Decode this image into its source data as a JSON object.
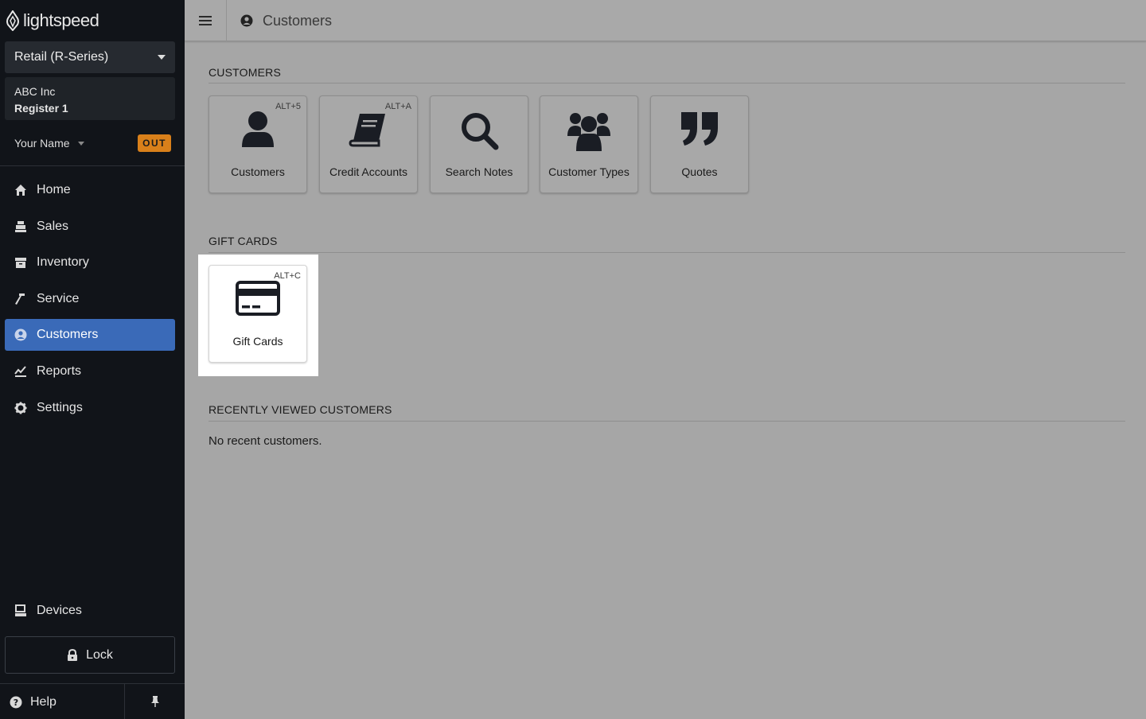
{
  "brand": {
    "logo_text": "lightspeed"
  },
  "sidebar": {
    "store_select": "Retail (R-Series)",
    "company": "ABC Inc",
    "register": "Register 1",
    "user_name": "Your Name",
    "status_badge": "OUT",
    "nav": [
      {
        "label": "Home",
        "icon": "home-icon"
      },
      {
        "label": "Sales",
        "icon": "register-icon"
      },
      {
        "label": "Inventory",
        "icon": "inventory-icon"
      },
      {
        "label": "Service",
        "icon": "hammer-icon"
      },
      {
        "label": "Customers",
        "icon": "user-circle-icon",
        "active": true
      },
      {
        "label": "Reports",
        "icon": "chart-icon"
      },
      {
        "label": "Settings",
        "icon": "gear-icon"
      }
    ],
    "devices_label": "Devices",
    "lock_label": "Lock",
    "help_label": "Help"
  },
  "header": {
    "title": "Customers"
  },
  "sections": {
    "customers": {
      "title": "CUSTOMERS",
      "tiles": [
        {
          "label": "Customers",
          "shortcut": "ALT+5",
          "icon": "user-icon"
        },
        {
          "label": "Credit Accounts",
          "shortcut": "ALT+A",
          "icon": "book-icon"
        },
        {
          "label": "Search Notes",
          "shortcut": "",
          "icon": "search-icon"
        },
        {
          "label": "Customer Types",
          "shortcut": "",
          "icon": "users-icon"
        },
        {
          "label": "Quotes",
          "shortcut": "",
          "icon": "quote-icon"
        }
      ]
    },
    "gift_cards": {
      "title": "GIFT CARDS",
      "tiles": [
        {
          "label": "Gift Cards",
          "shortcut": "ALT+C",
          "icon": "credit-card-icon"
        }
      ]
    },
    "recent": {
      "title": "RECENTLY VIEWED CUSTOMERS",
      "empty_text": "No recent customers."
    }
  },
  "colors": {
    "sidebar_bg": "#111419",
    "active_nav": "#3a6ab8",
    "badge": "#d9801a",
    "overlay_bg": "#a6a6a6"
  }
}
